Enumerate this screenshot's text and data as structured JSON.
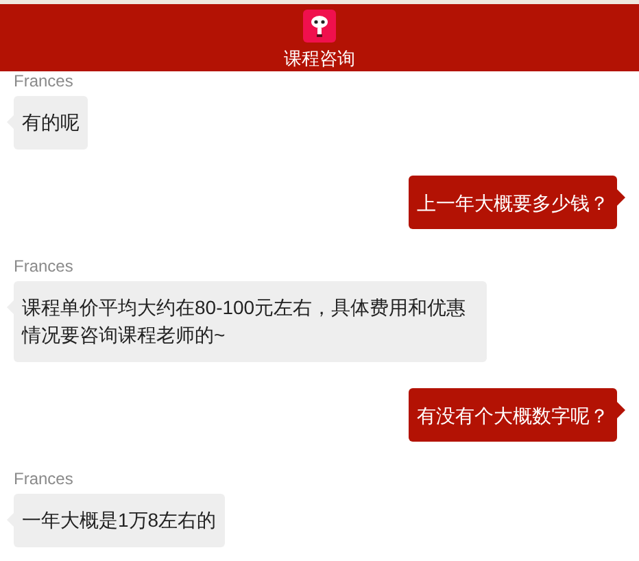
{
  "header": {
    "title": "课程咨询"
  },
  "messages": [
    {
      "kind": "received",
      "sender": "Frances",
      "text": "有的呢"
    },
    {
      "kind": "sent",
      "text": "上一年大概要多少钱？"
    },
    {
      "kind": "received",
      "sender": "Frances",
      "text": "课程单价平均大约在80-100元左右，具体费用和优惠情况要咨询课程老师的~"
    },
    {
      "kind": "sent",
      "text": "有没有个大概数字呢？"
    },
    {
      "kind": "received",
      "sender": "Frances",
      "text": "一年大概是1万8左右的"
    }
  ]
}
